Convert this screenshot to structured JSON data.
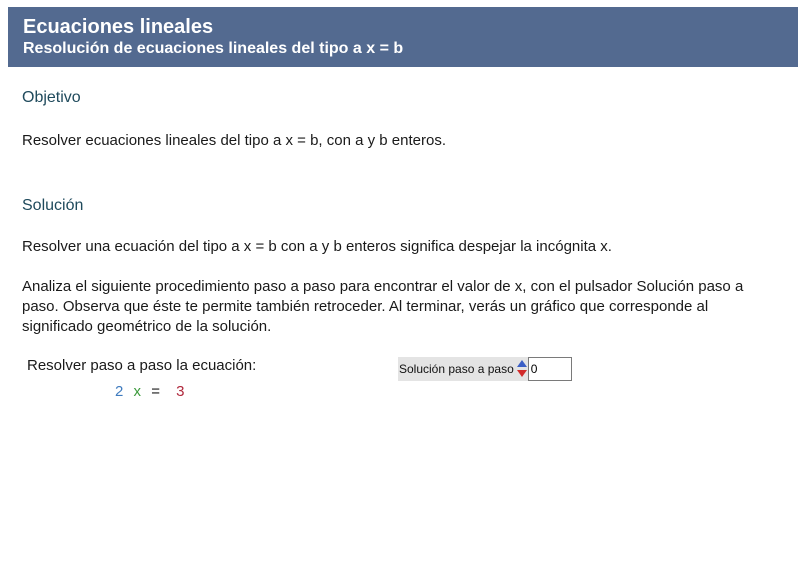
{
  "header": {
    "title": "Ecuaciones lineales",
    "subtitle": "Resolución de ecuaciones lineales del tipo a x = b"
  },
  "objetivo": {
    "heading": "Objetivo",
    "text": "Resolver ecuaciones lineales del tipo  a x = b, con a y b enteros."
  },
  "solucion": {
    "heading": "Solución",
    "text1": "Resolver una ecuación del tipo  a x = b  con  a  y  b  enteros significa despejar la incógnita  x.",
    "text2": "Analiza el siguiente procedimiento paso a paso para encontrar el valor de  x, con el pulsador Solución paso a paso. Observa que éste te permite también retroceder. Al terminar, verás un gráfico que corresponde al significado geométrico de la solución."
  },
  "problem": {
    "label": "Resolver paso a paso la ecuación:",
    "a": "2",
    "x": "x",
    "equals": "=",
    "b": "3"
  },
  "stepper": {
    "label": "Solución paso a paso",
    "value": "0"
  },
  "colors": {
    "header_bg": "#536a90",
    "coef_a": "#3f7bbf",
    "var_x": "#3c9a3c",
    "coef_b": "#b0283c",
    "arrow_up": "#3b5fc6",
    "arrow_down": "#d22b2b"
  },
  "icons": {
    "up": "triangle-up-icon",
    "down": "triangle-down-icon"
  }
}
